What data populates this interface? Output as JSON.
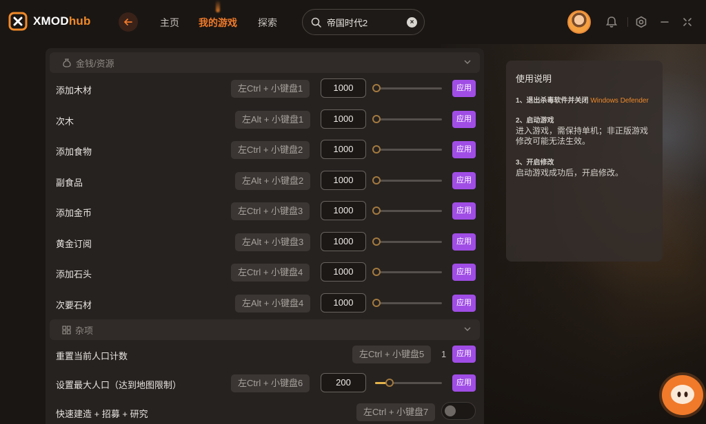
{
  "app": {
    "brand_main": "XMOD",
    "brand_accent": "hub"
  },
  "nav": [
    {
      "label": "主页",
      "active": false
    },
    {
      "label": "我的游戏",
      "active": true
    },
    {
      "label": "探索",
      "active": false
    }
  ],
  "search": {
    "value": "帝国时代2"
  },
  "sections": {
    "resources": {
      "title": "金钱/资源"
    },
    "misc": {
      "title": "杂项"
    }
  },
  "apply_label": "应用",
  "rows": [
    {
      "label": "添加木材",
      "hotkey": "左Ctrl + 小键盘1",
      "value": "1000"
    },
    {
      "label": "次木",
      "hotkey": "左Alt + 小键盘1",
      "value": "1000"
    },
    {
      "label": "添加食物",
      "hotkey": "左Ctrl + 小键盘2",
      "value": "1000"
    },
    {
      "label": "副食品",
      "hotkey": "左Alt + 小键盘2",
      "value": "1000"
    },
    {
      "label": "添加金币",
      "hotkey": "左Ctrl + 小键盘3",
      "value": "1000"
    },
    {
      "label": "黄金订阅",
      "hotkey": "左Alt + 小键盘3",
      "value": "1000"
    },
    {
      "label": "添加石头",
      "hotkey": "左Ctrl + 小键盘4",
      "value": "1000"
    },
    {
      "label": "次要石材",
      "hotkey": "左Alt + 小键盘4",
      "value": "1000"
    }
  ],
  "misc_rows": [
    {
      "label": "重置当前人口计数",
      "hotkey": "左Ctrl + 小键盘5",
      "value": "1"
    },
    {
      "label": "设置最大人口（达到地图限制）",
      "hotkey": "左Ctrl + 小键盘6",
      "value": "200",
      "slider_level": 0.2
    },
    {
      "label": "快速建造 + 招募 + 研究",
      "hotkey": "左Ctrl + 小键盘7",
      "toggle_on": false
    }
  ],
  "instructions": {
    "title": "使用说明",
    "step1_head": "1、退出杀毒软件并关闭",
    "step1_highlight": "Windows Defender",
    "step2_head": "2、启动游戏",
    "step2_body": "进入游戏，需保持单机；非正版游戏修改可能无法生效。",
    "step3_head": "3、开启修改",
    "step3_body": "启动游戏成功后，开启修改。"
  },
  "colors": {
    "accent": "#f07a2a",
    "apply": "#a04de6",
    "slider_fill": "#e4b34a"
  }
}
